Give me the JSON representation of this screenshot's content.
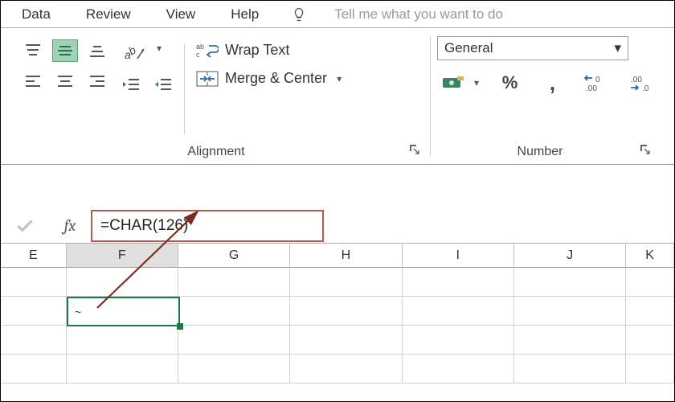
{
  "menu": {
    "tabs": [
      "Data",
      "Review",
      "View",
      "Help"
    ],
    "tellme_placeholder": "Tell me what you want to do"
  },
  "ribbon": {
    "alignment": {
      "label": "Alignment",
      "wrap_text": "Wrap Text",
      "merge_center": "Merge & Center"
    },
    "number": {
      "label": "Number",
      "format_selected": "General",
      "percent_symbol": "%",
      "comma_symbol": ","
    }
  },
  "formula_bar": {
    "fx_label": "fx",
    "formula": "=CHAR(126)"
  },
  "grid": {
    "columns": [
      "E",
      "F",
      "G",
      "H",
      "I",
      "J",
      "K"
    ],
    "active_column": "F",
    "active_cell_value": "~"
  }
}
